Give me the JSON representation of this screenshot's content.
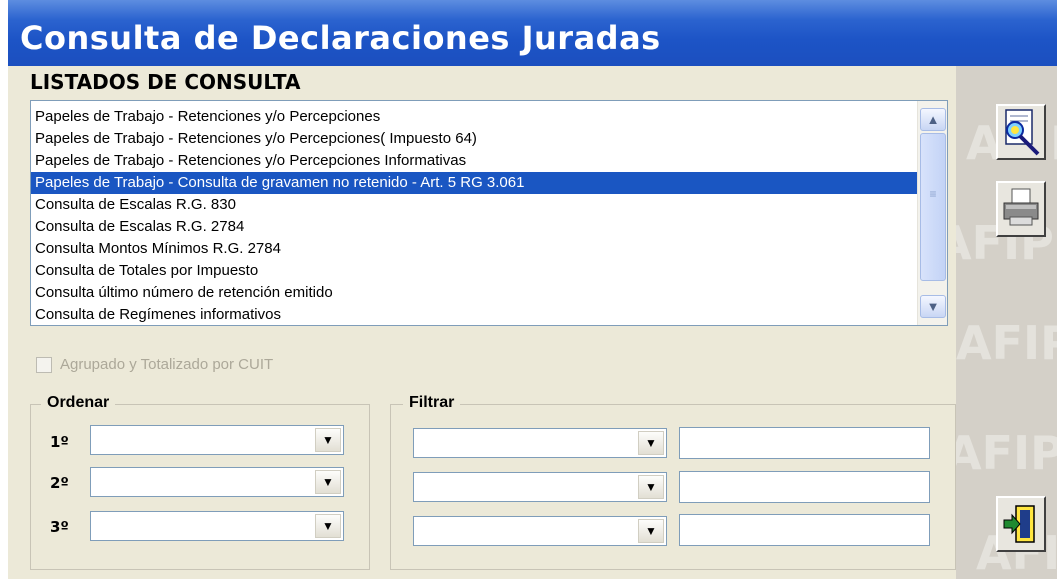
{
  "window": {
    "title": "Consulta de Declaraciones Juradas"
  },
  "listados": {
    "heading": "LISTADOS DE CONSULTA",
    "items": [
      "Papeles de Trabajo - Retenciones y/o Percepciones",
      "Papeles de Trabajo - Retenciones y/o Percepciones( Impuesto 64)",
      "Papeles de Trabajo - Retenciones y/o Percepciones Informativas",
      "Papeles de Trabajo - Consulta de gravamen no retenido - Art. 5 RG 3.061",
      "Consulta de Escalas R.G. 830",
      "Consulta de Escalas R.G. 2784",
      "Consulta Montos Mínimos R.G. 2784",
      "Consulta de Totales por Impuesto",
      "Consulta último número de retención emitido",
      "Consulta de Regímenes informativos"
    ],
    "selected_index": 3
  },
  "agrupado": {
    "label": "Agrupado y Totalizado por CUIT",
    "checked": false,
    "enabled": false
  },
  "ordenar": {
    "legend": "Ordenar",
    "rows": [
      {
        "label": "1º",
        "value": ""
      },
      {
        "label": "2º",
        "value": ""
      },
      {
        "label": "3º",
        "value": ""
      }
    ]
  },
  "filtrar": {
    "legend": "Filtrar",
    "rows": [
      {
        "field": "",
        "value": ""
      },
      {
        "field": "",
        "value": ""
      },
      {
        "field": "",
        "value": ""
      }
    ]
  },
  "icons": {
    "scroll_up": "▲",
    "scroll_down": "▼",
    "thumb_grip": "≡",
    "dropdown": "▼",
    "preview": "preview-icon",
    "print": "printer-icon",
    "exit": "exit-door-icon"
  },
  "watermark": "AFIP",
  "colors": {
    "titlebar": "#1d54c6",
    "selection": "#1a56c2",
    "panel": "#ece9d8"
  }
}
